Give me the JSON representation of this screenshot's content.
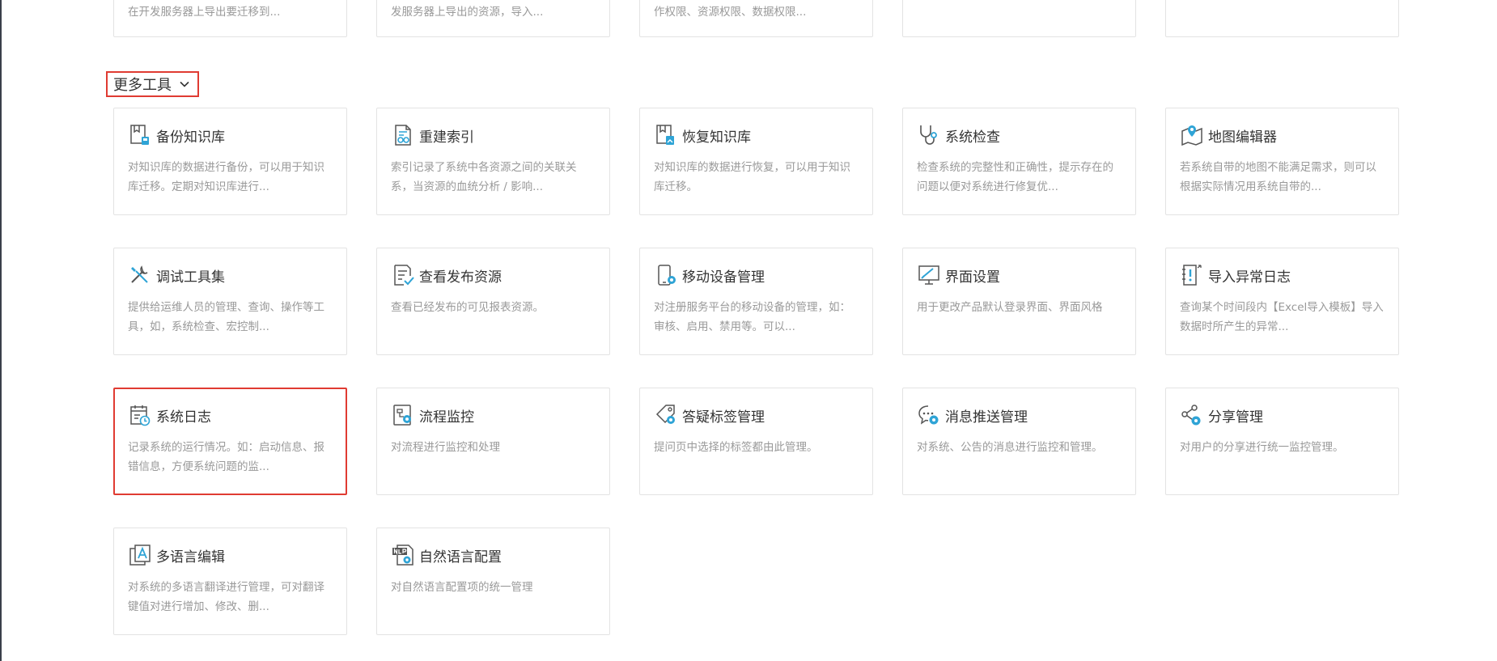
{
  "top_cards": [
    {
      "desc": "在开发服务器上导出要迁移到..."
    },
    {
      "desc": "发服务器上导出的资源，导入..."
    },
    {
      "desc": "作权限、资源权限、数据权限..."
    },
    {
      "desc": ""
    },
    {
      "desc": ""
    }
  ],
  "section": {
    "title": "更多工具",
    "toggle_icon": "chevron-down-icon"
  },
  "colors": {
    "accent": "#2fa4d6",
    "highlight": "#e03b32",
    "border": "#e3e3e3",
    "desc": "#999999"
  },
  "tools": [
    {
      "key": "backup-kb",
      "icon": "backup-knowledge-icon",
      "title": "备份知识库",
      "desc": "对知识库的数据进行备份，可以用于知识库迁移。定期对知识库进行..."
    },
    {
      "key": "rebuild-index",
      "icon": "rebuild-index-icon",
      "title": "重建索引",
      "desc": "索引记录了系统中各资源之间的关联关系，当资源的血统分析 / 影响..."
    },
    {
      "key": "restore-kb",
      "icon": "restore-knowledge-icon",
      "title": "恢复知识库",
      "desc": "对知识库的数据进行恢复，可以用于知识库迁移。"
    },
    {
      "key": "system-check",
      "icon": "stethoscope-icon",
      "title": "系统检查",
      "desc": "检查系统的完整性和正确性，提示存在的问题以便对系统进行修复优..."
    },
    {
      "key": "map-editor",
      "icon": "map-pin-icon",
      "title": "地图编辑器",
      "desc": "若系统自带的地图不能满足需求，则可以根据实际情况用系统自带的..."
    },
    {
      "key": "debug-tools",
      "icon": "tools-icon",
      "title": "调试工具集",
      "desc": "提供给运维人员的管理、查询、操作等工具，如，系统检查、宏控制..."
    },
    {
      "key": "view-published",
      "icon": "publish-check-icon",
      "title": "查看发布资源",
      "desc": "查看已经发布的可见报表资源。"
    },
    {
      "key": "mobile-devices",
      "icon": "mobile-device-icon",
      "title": "移动设备管理",
      "desc": "对注册服务平台的移动设备的管理，如：审核、启用、禁用等。可以..."
    },
    {
      "key": "ui-settings",
      "icon": "monitor-icon",
      "title": "界面设置",
      "desc": "用于更改产品默认登录界面、界面风格"
    },
    {
      "key": "import-error-log",
      "icon": "import-error-icon",
      "title": "导入异常日志",
      "desc": "查询某个时间段内【Excel导入模板】导入数据时所产生的异常..."
    },
    {
      "key": "system-log",
      "icon": "calendar-clock-icon",
      "title": "系统日志",
      "desc": "记录系统的运行情况。如：启动信息、报错信息，方便系统问题的监...",
      "selected": true
    },
    {
      "key": "flow-monitor",
      "icon": "flow-icon",
      "title": "流程监控",
      "desc": "对流程进行监控和处理"
    },
    {
      "key": "qa-tags",
      "icon": "tag-gear-icon",
      "title": "答疑标签管理",
      "desc": "提问页中选择的标签都由此管理。"
    },
    {
      "key": "message-push",
      "icon": "chat-gear-icon",
      "title": "消息推送管理",
      "desc": "对系统、公告的消息进行监控和管理。"
    },
    {
      "key": "share-mgmt",
      "icon": "share-gear-icon",
      "title": "分享管理",
      "desc": "对用户的分享进行统一监控管理。"
    },
    {
      "key": "i18n-editor",
      "icon": "language-icon",
      "title": "多语言编辑",
      "desc": "对系统的多语言翻译进行管理，可对翻译键值对进行增加、修改、删..."
    },
    {
      "key": "nlp-config",
      "icon": "nlp-doc-icon",
      "title": "自然语言配置",
      "desc": "对自然语言配置项的统一管理"
    }
  ]
}
